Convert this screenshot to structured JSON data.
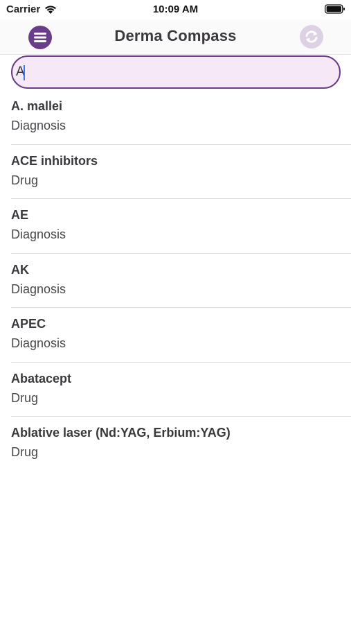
{
  "status_bar": {
    "carrier": "Carrier",
    "time": "10:09 AM"
  },
  "navbar": {
    "title": "Derma Compass",
    "menu_icon": "menu-lines-icon",
    "sync_icon": "refresh-icon"
  },
  "search": {
    "value": "A",
    "placeholder": ""
  },
  "results": [
    {
      "name": "A. mallei",
      "kind": "Diagnosis"
    },
    {
      "name": "ACE inhibitors",
      "kind": "Drug"
    },
    {
      "name": "AE",
      "kind": "Diagnosis"
    },
    {
      "name": "AK",
      "kind": "Diagnosis"
    },
    {
      "name": "APEC",
      "kind": "Diagnosis"
    },
    {
      "name": "Abatacept",
      "kind": "Drug"
    },
    {
      "name": "Ablative laser (Nd:YAG, Erbium:YAG)",
      "kind": "Drug"
    }
  ],
  "colors": {
    "accent": "#6a3d8a",
    "search_bg": "#f7e8f7",
    "sync_disabled": "#ddd1e6"
  }
}
